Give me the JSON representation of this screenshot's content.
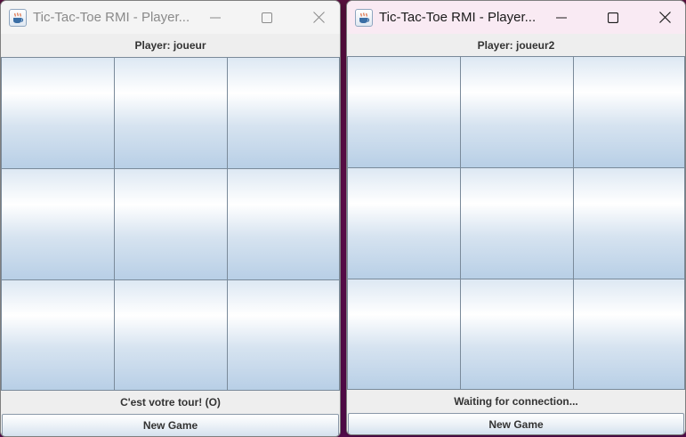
{
  "windows": [
    {
      "title": "Tic-Tac-Toe RMI - Player...",
      "player_label": "Player: joueur",
      "status": "C'est votre tour! (O)",
      "new_game_label": "New Game",
      "active": false,
      "board": [
        "",
        "",
        "",
        "",
        "",
        "",
        "",
        "",
        ""
      ]
    },
    {
      "title": "Tic-Tac-Toe RMI - Player...",
      "player_label": "Player: joueur2",
      "status": "Waiting for connection...",
      "new_game_label": "New Game",
      "active": true,
      "board": [
        "",
        "",
        "",
        "",
        "",
        "",
        "",
        "",
        ""
      ]
    }
  ],
  "icons": {
    "app": "java-coffee-cup-icon",
    "minimize": "minimize-icon",
    "maximize": "maximize-icon",
    "close": "close-icon"
  },
  "colors": {
    "inactive_title_text": "#8a8a8a",
    "active_title_text": "#1a1a1a",
    "active_titlebar": "#f9eaf3",
    "cell_gradient_bottom": "#b8cfe6",
    "desktop": "#6a0f55"
  }
}
